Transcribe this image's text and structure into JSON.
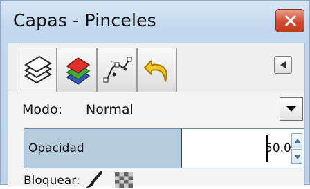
{
  "window": {
    "title": "Capas - Pinceles",
    "close_icon": "close-icon"
  },
  "tabs": [
    {
      "name": "layers",
      "icon": "layers-icon",
      "active": true
    },
    {
      "name": "channels",
      "icon": "channels-icon",
      "active": false
    },
    {
      "name": "paths",
      "icon": "paths-icon",
      "active": false
    },
    {
      "name": "undo-history",
      "icon": "undo-history-icon",
      "active": false
    }
  ],
  "tab_menu_icon": "triangle-left-icon",
  "mode": {
    "label": "Modo:",
    "value": "Normal"
  },
  "opacity": {
    "label": "Opacidad",
    "value": "50.0",
    "fraction": 0.5
  },
  "lock": {
    "label": "Bloquear:",
    "icons": [
      "brush-lock-icon",
      "alpha-lock-icon"
    ]
  },
  "colors": {
    "close_red": "#d24a31",
    "opacity_fill": "#b6cbdd",
    "frame_blue": "#c3d8ee"
  }
}
